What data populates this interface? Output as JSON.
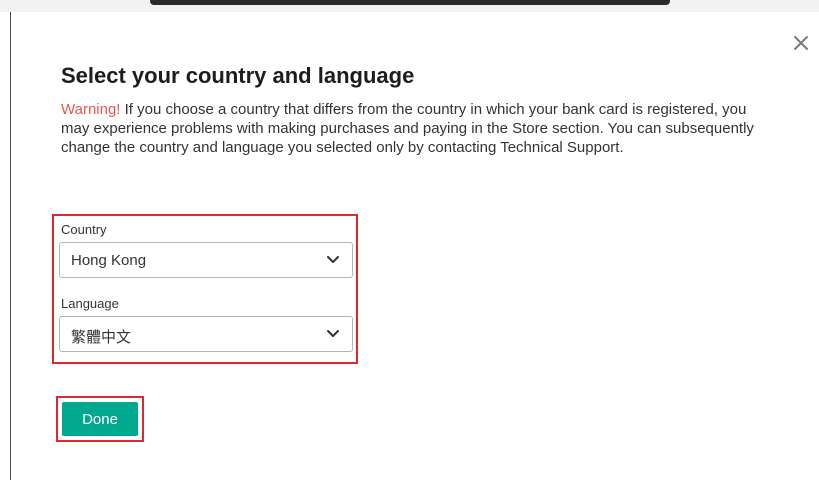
{
  "dialog": {
    "title": "Select your country and language",
    "warning_label": "Warning!",
    "warning_text": " If you choose a country that differs from the country in which your bank card is registered, you may experience problems with making purchases and paying in the Store section. You can subsequently change the country and language you selected only by contacting Technical Support.",
    "close_icon": "close-icon"
  },
  "country": {
    "label": "Country",
    "value": "Hong Kong"
  },
  "language": {
    "label": "Language",
    "value": "繁體中文"
  },
  "actions": {
    "done_label": "Done"
  },
  "colors": {
    "accent": "#00a88e",
    "warning": "#e8594b",
    "highlight": "#e0262e"
  }
}
